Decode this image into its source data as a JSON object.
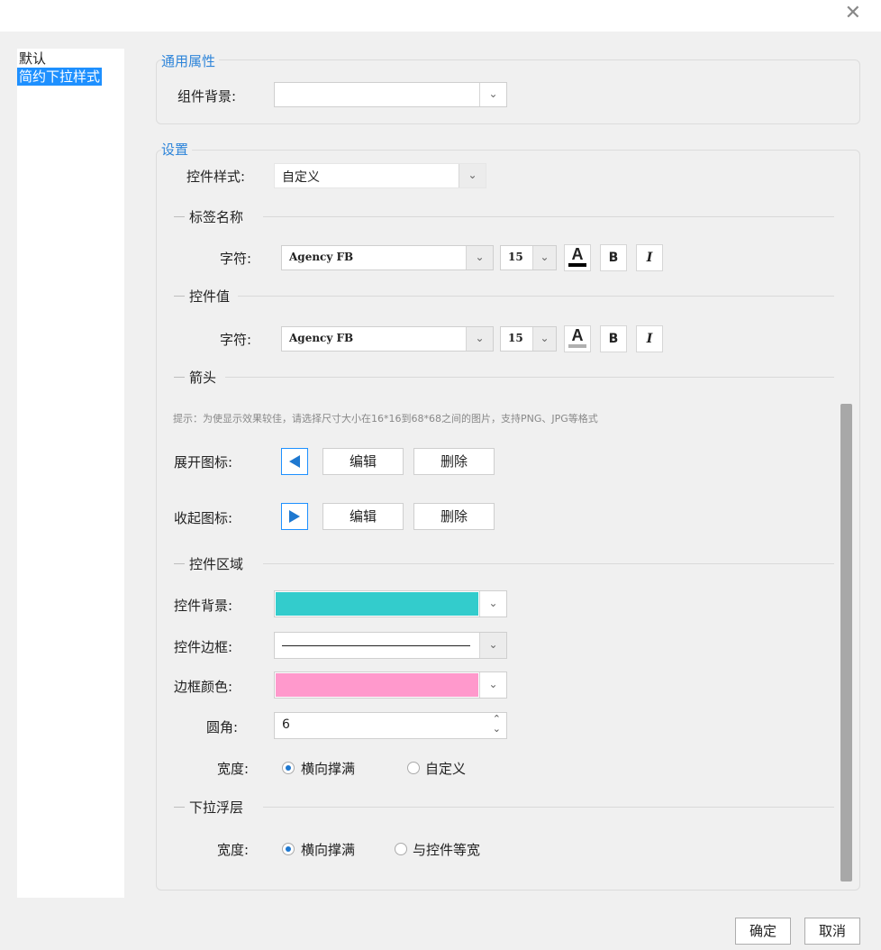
{
  "window": {
    "close_symbol": "✕"
  },
  "left_list": {
    "items": [
      {
        "label": "默认"
      },
      {
        "label": "简约下拉样式"
      }
    ]
  },
  "general": {
    "title": "通用属性",
    "bg_label": "组件背景:"
  },
  "settings": {
    "title": "设置",
    "style_label": "控件样式:",
    "style_value": "自定义",
    "label_name": {
      "title": "标签名称",
      "char_label": "字符:",
      "font": "Agency FB",
      "size": "15",
      "font_color": "#000000",
      "bold_label": "B",
      "italic_label": "I"
    },
    "control_value": {
      "title": "控件值",
      "char_label": "字符:",
      "font": "Agency FB",
      "size": "15",
      "font_color": "#b0b0b0",
      "bold_label": "B",
      "italic_label": "I"
    },
    "arrow": {
      "title": "箭头",
      "hint": "提示：为使显示效果较佳，请选择尺寸大小在16*16到68*68之间的图片，支持PNG、JPG等格式",
      "expand_label": "展开图标:",
      "collapse_label": "收起图标:",
      "edit_label": "编辑",
      "delete_label": "删除"
    },
    "control_area": {
      "title": "控件区域",
      "bg_label": "控件背景:",
      "bg_color": "#33cccc",
      "border_label": "控件边框:",
      "border_color_label": "边框颜色:",
      "border_color": "#ff99cc",
      "radius_label": "圆角:",
      "radius_value": "6",
      "width_label": "宽度:",
      "width_opt1": "横向撑满",
      "width_opt2": "自定义"
    },
    "dropdown_layer": {
      "title": "下拉浮层",
      "width_label": "宽度:",
      "opt1": "横向撑满",
      "opt2": "与控件等宽"
    }
  },
  "footer": {
    "ok_label": "确定",
    "cancel_label": "取消"
  }
}
